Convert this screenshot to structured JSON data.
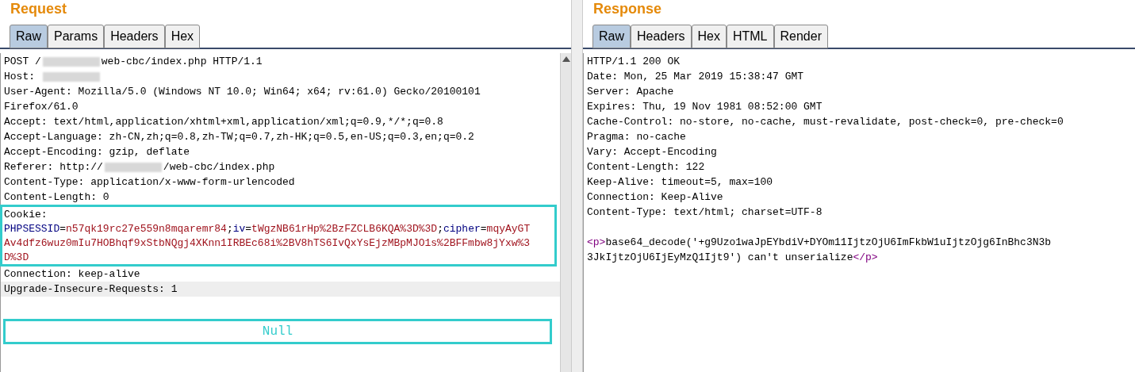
{
  "request": {
    "title": "Request",
    "tabs": [
      {
        "label": "Raw",
        "selected": true
      },
      {
        "label": "Params",
        "selected": false
      },
      {
        "label": "Headers",
        "selected": false
      },
      {
        "label": "Hex",
        "selected": false
      }
    ],
    "lines": [
      {
        "boxed": false,
        "highlighted": false,
        "segments": [
          {
            "kind": "text",
            "text": "POST /"
          },
          {
            "kind": "redacted"
          },
          {
            "kind": "text",
            "text": "web-cbc/index.php HTTP/1.1"
          }
        ]
      },
      {
        "boxed": false,
        "highlighted": false,
        "segments": [
          {
            "kind": "text",
            "text": "Host: "
          },
          {
            "kind": "redacted"
          }
        ]
      },
      {
        "boxed": false,
        "highlighted": false,
        "segments": [
          {
            "kind": "text",
            "text": "User-Agent: Mozilla/5.0 (Windows NT 10.0; Win64; x64; rv:61.0) Gecko/20100101"
          }
        ]
      },
      {
        "boxed": false,
        "highlighted": false,
        "segments": [
          {
            "kind": "text",
            "text": "Firefox/61.0"
          }
        ]
      },
      {
        "boxed": false,
        "highlighted": false,
        "segments": [
          {
            "kind": "text",
            "text": "Accept: text/html,application/xhtml+xml,application/xml;q=0.9,*/*;q=0.8"
          }
        ]
      },
      {
        "boxed": false,
        "highlighted": false,
        "segments": [
          {
            "kind": "text",
            "text": "Accept-Language: zh-CN,zh;q=0.8,zh-TW;q=0.7,zh-HK;q=0.5,en-US;q=0.3,en;q=0.2"
          }
        ]
      },
      {
        "boxed": false,
        "highlighted": false,
        "segments": [
          {
            "kind": "text",
            "text": "Accept-Encoding: gzip, deflate"
          }
        ]
      },
      {
        "boxed": false,
        "highlighted": false,
        "segments": [
          {
            "kind": "text",
            "text": "Referer: http://"
          },
          {
            "kind": "redacted"
          },
          {
            "kind": "text",
            "text": "/web-cbc/index.php"
          }
        ]
      },
      {
        "boxed": false,
        "highlighted": false,
        "segments": [
          {
            "kind": "text",
            "text": "Content-Type: application/x-www-form-urlencoded"
          }
        ]
      },
      {
        "boxed": false,
        "highlighted": false,
        "segments": [
          {
            "kind": "text",
            "text": "Content-Length: 0"
          }
        ]
      },
      {
        "boxed": true,
        "highlighted": false,
        "segments": [
          {
            "kind": "text",
            "text": "Cookie:"
          }
        ]
      },
      {
        "boxed": true,
        "highlighted": false,
        "segments": [
          {
            "kind": "name",
            "text": "PHPSESSID"
          },
          {
            "kind": "text",
            "text": "="
          },
          {
            "kind": "value",
            "text": "n57qk19rc27e559n8mqaremr84"
          },
          {
            "kind": "text",
            "text": ";"
          },
          {
            "kind": "name",
            "text": "iv"
          },
          {
            "kind": "text",
            "text": "="
          },
          {
            "kind": "value",
            "text": "tWgzNB61rHp%2BzFZCLB6KQA%3D%3D"
          },
          {
            "kind": "text",
            "text": ";"
          },
          {
            "kind": "name",
            "text": "cipher"
          },
          {
            "kind": "text",
            "text": "="
          },
          {
            "kind": "value",
            "text": "mqyAyGT"
          }
        ]
      },
      {
        "boxed": true,
        "highlighted": false,
        "segments": [
          {
            "kind": "value",
            "text": "Av4dfz6wuz0mIu7HOBhqf9xStbNQgj4XKnn1IRBEc68i%2BV8hTS6IvQxYsEjzMBpMJO1s%2BFFmbw8jYxw%3"
          }
        ]
      },
      {
        "boxed": true,
        "highlighted": false,
        "segments": [
          {
            "kind": "value",
            "text": "D%3D"
          }
        ]
      },
      {
        "boxed": false,
        "highlighted": false,
        "segments": [
          {
            "kind": "text",
            "text": "Connection: keep-alive"
          }
        ]
      },
      {
        "boxed": false,
        "highlighted": true,
        "segments": [
          {
            "kind": "text",
            "text": "Upgrade-Insecure-Requests: 1"
          }
        ]
      }
    ],
    "note": "Null"
  },
  "response": {
    "title": "Response",
    "tabs": [
      {
        "label": "Raw",
        "selected": true
      },
      {
        "label": "Headers",
        "selected": false
      },
      {
        "label": "Hex",
        "selected": false
      },
      {
        "label": "HTML",
        "selected": false
      },
      {
        "label": "Render",
        "selected": false
      }
    ],
    "lines": [
      {
        "boxed": false,
        "highlighted": false,
        "segments": [
          {
            "kind": "text",
            "text": "HTTP/1.1 200 OK"
          }
        ]
      },
      {
        "boxed": false,
        "highlighted": false,
        "segments": [
          {
            "kind": "text",
            "text": "Date: Mon, 25 Mar 2019 15:38:47 GMT"
          }
        ]
      },
      {
        "boxed": false,
        "highlighted": false,
        "segments": [
          {
            "kind": "text",
            "text": "Server: Apache"
          }
        ]
      },
      {
        "boxed": false,
        "highlighted": false,
        "segments": [
          {
            "kind": "text",
            "text": "Expires: Thu, 19 Nov 1981 08:52:00 GMT"
          }
        ]
      },
      {
        "boxed": false,
        "highlighted": false,
        "segments": [
          {
            "kind": "text",
            "text": "Cache-Control: no-store, no-cache, must-revalidate, post-check=0, pre-check=0"
          }
        ]
      },
      {
        "boxed": false,
        "highlighted": false,
        "segments": [
          {
            "kind": "text",
            "text": "Pragma: no-cache"
          }
        ]
      },
      {
        "boxed": false,
        "highlighted": false,
        "segments": [
          {
            "kind": "text",
            "text": "Vary: Accept-Encoding"
          }
        ]
      },
      {
        "boxed": false,
        "highlighted": false,
        "segments": [
          {
            "kind": "text",
            "text": "Content-Length: 122"
          }
        ]
      },
      {
        "boxed": false,
        "highlighted": false,
        "segments": [
          {
            "kind": "text",
            "text": "Keep-Alive: timeout=5, max=100"
          }
        ]
      },
      {
        "boxed": false,
        "highlighted": false,
        "segments": [
          {
            "kind": "text",
            "text": "Connection: Keep-Alive"
          }
        ]
      },
      {
        "boxed": false,
        "highlighted": false,
        "segments": [
          {
            "kind": "text",
            "text": "Content-Type: text/html; charset=UTF-8"
          }
        ]
      }
    ],
    "body_lines": [
      {
        "boxed": false,
        "highlighted": false,
        "segments": [
          {
            "kind": "tag",
            "text": "<p>"
          },
          {
            "kind": "text",
            "text": "base64_decode('+g9Uzo1waJpEYbdiV+DYOm11IjtzOjU6ImFkbW1uIjtzOjg6InBhc3N3b"
          }
        ]
      },
      {
        "boxed": false,
        "highlighted": false,
        "segments": [
          {
            "kind": "text",
            "text": "3JkIjtzOjU6IjEyMzQ1Ijt9') can't unserialize"
          },
          {
            "kind": "tag",
            "text": "</p>"
          }
        ]
      }
    ]
  }
}
